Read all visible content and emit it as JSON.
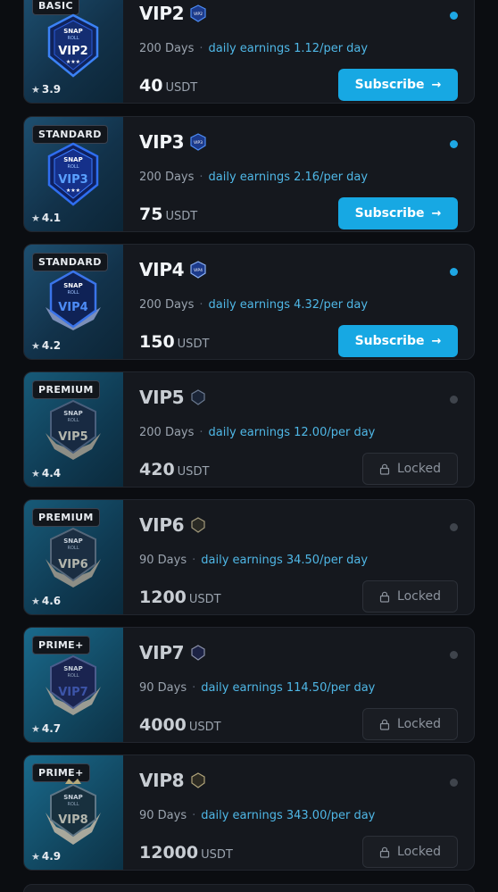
{
  "cards": [
    {
      "tier": "BASIC",
      "rating": "3.9",
      "title": "VIP2",
      "emblem": "VIP2",
      "duration": "200 Days",
      "earnings": "daily earnings 1.12/per day",
      "price": "40",
      "unit": "USDT",
      "active": true,
      "button": "Subscribe",
      "button_icon": "arrow-right-icon",
      "tier_style": "basic"
    },
    {
      "tier": "STANDARD",
      "rating": "4.1",
      "title": "VIP3",
      "emblem": "VIP3",
      "duration": "200 Days",
      "earnings": "daily earnings 2.16/per day",
      "price": "75",
      "unit": "USDT",
      "active": true,
      "button": "Subscribe",
      "button_icon": "arrow-right-icon",
      "tier_style": "standard"
    },
    {
      "tier": "STANDARD",
      "rating": "4.2",
      "title": "VIP4",
      "emblem": "VIP4",
      "duration": "200 Days",
      "earnings": "daily earnings 4.32/per day",
      "price": "150",
      "unit": "USDT",
      "active": true,
      "button": "Subscribe",
      "button_icon": "arrow-right-icon",
      "tier_style": "standard"
    },
    {
      "tier": "PREMIUM",
      "rating": "4.4",
      "title": "VIP5",
      "emblem": "VIP5",
      "duration": "200 Days",
      "earnings": "daily earnings 12.00/per day",
      "price": "420",
      "unit": "USDT",
      "active": false,
      "button": "Locked",
      "button_icon": "lock-icon",
      "tier_style": "premium"
    },
    {
      "tier": "PREMIUM",
      "rating": "4.6",
      "title": "VIP6",
      "emblem": "VIP6",
      "duration": "90 Days",
      "earnings": "daily earnings 34.50/per day",
      "price": "1200",
      "unit": "USDT",
      "active": false,
      "button": "Locked",
      "button_icon": "lock-icon",
      "tier_style": "premium"
    },
    {
      "tier": "PRIME+",
      "rating": "4.7",
      "title": "VIP7",
      "emblem": "VIP7",
      "duration": "90 Days",
      "earnings": "daily earnings 114.50/per day",
      "price": "4000",
      "unit": "USDT",
      "active": false,
      "button": "Locked",
      "button_icon": "lock-icon",
      "tier_style": "prime"
    },
    {
      "tier": "PRIME+",
      "rating": "4.9",
      "title": "VIP8",
      "emblem": "VIP8",
      "duration": "90 Days",
      "earnings": "daily earnings 343.00/per day",
      "price": "12000",
      "unit": "USDT",
      "active": false,
      "button": "Locked",
      "button_icon": "lock-icon",
      "tier_style": "prime"
    }
  ],
  "emblem_brand": [
    "SNAP",
    "ROLL"
  ],
  "colors": {
    "accent": "#17a8e3",
    "earnings_text": "#4fb7e6",
    "active_dot": "#1ea7e4",
    "inactive_dot": "#3f444c",
    "card_bg": "#15181e",
    "page_bg": "#0b0d11"
  }
}
